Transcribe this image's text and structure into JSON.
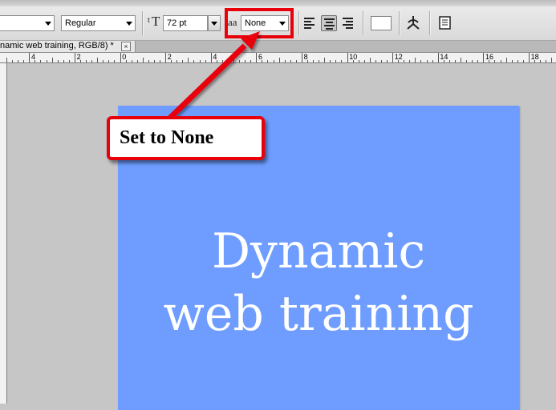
{
  "options_bar": {
    "font_style": "Regular",
    "font_size": "72 pt",
    "anti_alias_icon_label": "aa",
    "anti_alias_value": "None",
    "text_size_icon_label": "T"
  },
  "document_tab": {
    "title": "namic web training, RGB/8) *",
    "close_glyph": "×"
  },
  "ruler": {
    "labels": [
      "4",
      "2",
      "0",
      "2",
      "4",
      "6",
      "8",
      "10",
      "12",
      "14",
      "16",
      "18"
    ]
  },
  "canvas": {
    "line1": "Dynamic",
    "line2": "web training",
    "background": "#6e9dff",
    "text_color": "#ffffff"
  },
  "annotation": {
    "callout_text": "Set to None",
    "color": "#e8000b"
  },
  "icons": [
    "text-size-icon",
    "anti-alias-icon",
    "align-left-icon",
    "align-center-icon",
    "align-right-icon",
    "text-color-swatch",
    "warp-text-icon",
    "character-panel-icon",
    "arrow-down-icon",
    "close-icon"
  ]
}
